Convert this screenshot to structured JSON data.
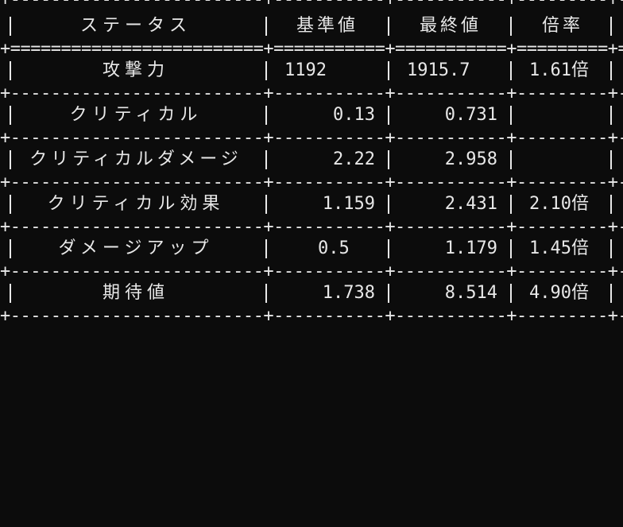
{
  "table": {
    "headers": [
      "ステータス",
      "基準値",
      "最終値",
      "倍率"
    ],
    "rows": [
      {
        "name": "攻撃力",
        "base": "1192",
        "final": "1915.7",
        "ratio": "1.61倍"
      },
      {
        "name": "クリティカル",
        "base": "0.13",
        "final": "0.731",
        "ratio": ""
      },
      {
        "name": "クリティカルダメージ",
        "base": "2.22",
        "final": "2.958",
        "ratio": ""
      },
      {
        "name": "クリティカル効果",
        "base": "1.159",
        "final": "2.431",
        "ratio": "2.10倍"
      },
      {
        "name": "ダメージアップ",
        "base": "0.5",
        "final": "1.179",
        "ratio": "1.45倍"
      },
      {
        "name": "期待値",
        "base": "1.738",
        "final": "8.514",
        "ratio": "4.90倍"
      }
    ]
  },
  "colors": {
    "background": "#0c0c0c",
    "foreground": "#e8e8e8"
  }
}
